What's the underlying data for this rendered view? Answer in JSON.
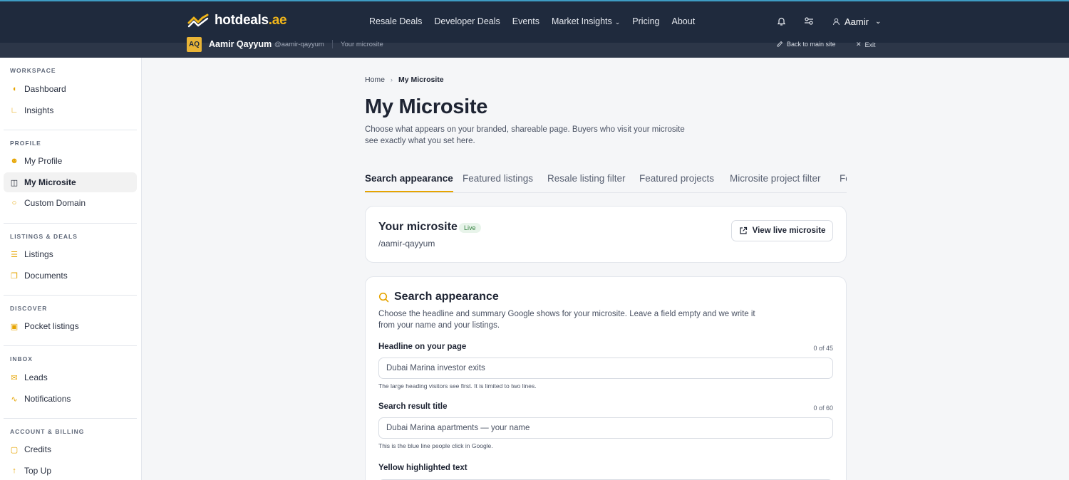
{
  "topnav": {
    "logo_text": "hotdeals",
    "logo_tld": ".ae",
    "links": [
      "Resale Deals",
      "Developer Deals",
      "Events",
      "Market Insights",
      "Pricing",
      "About"
    ],
    "icons": [
      "bell-icon",
      "sliders-icon"
    ],
    "user_name": "Aamir"
  },
  "subbar": {
    "initials": "AQ",
    "name": "Aamir Qayyum",
    "handle": "@aamir-qayyum",
    "crumb": "Your microsite",
    "back_label": "Back to main site",
    "exit_label": "Exit"
  },
  "sidebar": {
    "sections": [
      {
        "title": "WORKSPACE",
        "items": [
          {
            "label": "Dashboard",
            "icon": "gauge-icon"
          },
          {
            "label": "Insights",
            "icon": "chart-icon"
          }
        ]
      },
      {
        "title": "PROFILE",
        "items": [
          {
            "label": "My Profile",
            "icon": "user-icon"
          },
          {
            "label": "My Microsite",
            "icon": "columns-icon"
          },
          {
            "label": "Custom Domain",
            "icon": "globe-icon"
          }
        ]
      },
      {
        "title": "LISTINGS & DEALS",
        "items": [
          {
            "label": "Listings",
            "icon": "list-icon"
          },
          {
            "label": "Documents",
            "icon": "copy-icon"
          }
        ]
      },
      {
        "title": "DISCOVER",
        "items": [
          {
            "label": "Pocket listings",
            "icon": "lock-icon"
          }
        ]
      },
      {
        "title": "INBOX",
        "items": [
          {
            "label": "Leads",
            "icon": "mail-icon"
          },
          {
            "label": "Notifications",
            "icon": "activity-icon"
          }
        ]
      },
      {
        "title": "ACCOUNT & BILLING",
        "items": [
          {
            "label": "Credits",
            "icon": "wallet-icon"
          },
          {
            "label": "Top Up",
            "icon": "arrow-up-icon"
          }
        ]
      }
    ],
    "active": "My Microsite"
  },
  "main": {
    "breadcrumb": {
      "home": "Home",
      "current": "My Microsite"
    },
    "title": "My Microsite",
    "subtitle": "Choose what appears on your branded, shareable page. Buyers who visit your microsite see exactly what you set here.",
    "tabs": [
      "Search appearance",
      "Featured listings",
      "Resale listing filter",
      "Featured projects",
      "Microsite project filter",
      "Fe"
    ],
    "active_tab": "Search appearance",
    "microsite_card": {
      "title": "Your microsite",
      "badge": "Live",
      "handle": "/aamir-qayyum",
      "button": "View live microsite"
    },
    "search_card": {
      "title": "Search appearance",
      "description": "Choose the headline and summary Google shows for your microsite. Leave a field empty and we write it from your name and your listings.",
      "fields": [
        {
          "label": "Headline on your page",
          "count": "0 of 45",
          "placeholder": "Dubai Marina investor exits",
          "help": "The large heading visitors see first. It is limited to two lines."
        },
        {
          "label": "Search result title",
          "count": "0 of 60",
          "placeholder": "Dubai Marina apartments — your name",
          "help": "This is the blue line people click in Google."
        },
        {
          "label": "Yellow highlighted text"
        }
      ]
    }
  },
  "colors": {
    "nav_bg": "#1f2a3d",
    "accent": "#e6a400",
    "brand_yellow": "#f0b51a"
  }
}
